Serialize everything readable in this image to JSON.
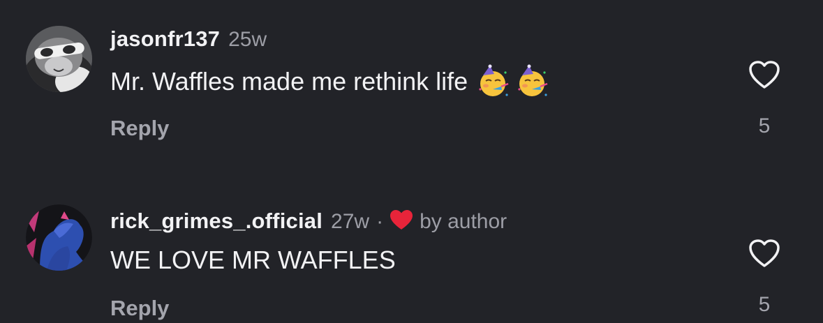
{
  "colors": {
    "background": "#222328",
    "primary_text": "#f2f2f4",
    "secondary_text": "#9d9ea6",
    "author_heart": "#e8243a"
  },
  "comments": [
    {
      "username": "jasonfr137",
      "time": "25w",
      "text": "Mr. Waffles made me rethink life",
      "emojis": [
        "partying-face-emoji",
        "partying-face-emoji"
      ],
      "reply_label": "Reply",
      "likes": "5",
      "like_icon": "heart-outline-icon"
    },
    {
      "username": "rick_grimes_.official",
      "time": "27w",
      "separator": "·",
      "liked_by_author_icon": "red-heart-icon",
      "liked_by_author_label": "by author",
      "text": "WE LOVE MR WAFFLES",
      "reply_label": "Reply",
      "likes": "5",
      "like_icon": "heart-outline-icon"
    }
  ]
}
